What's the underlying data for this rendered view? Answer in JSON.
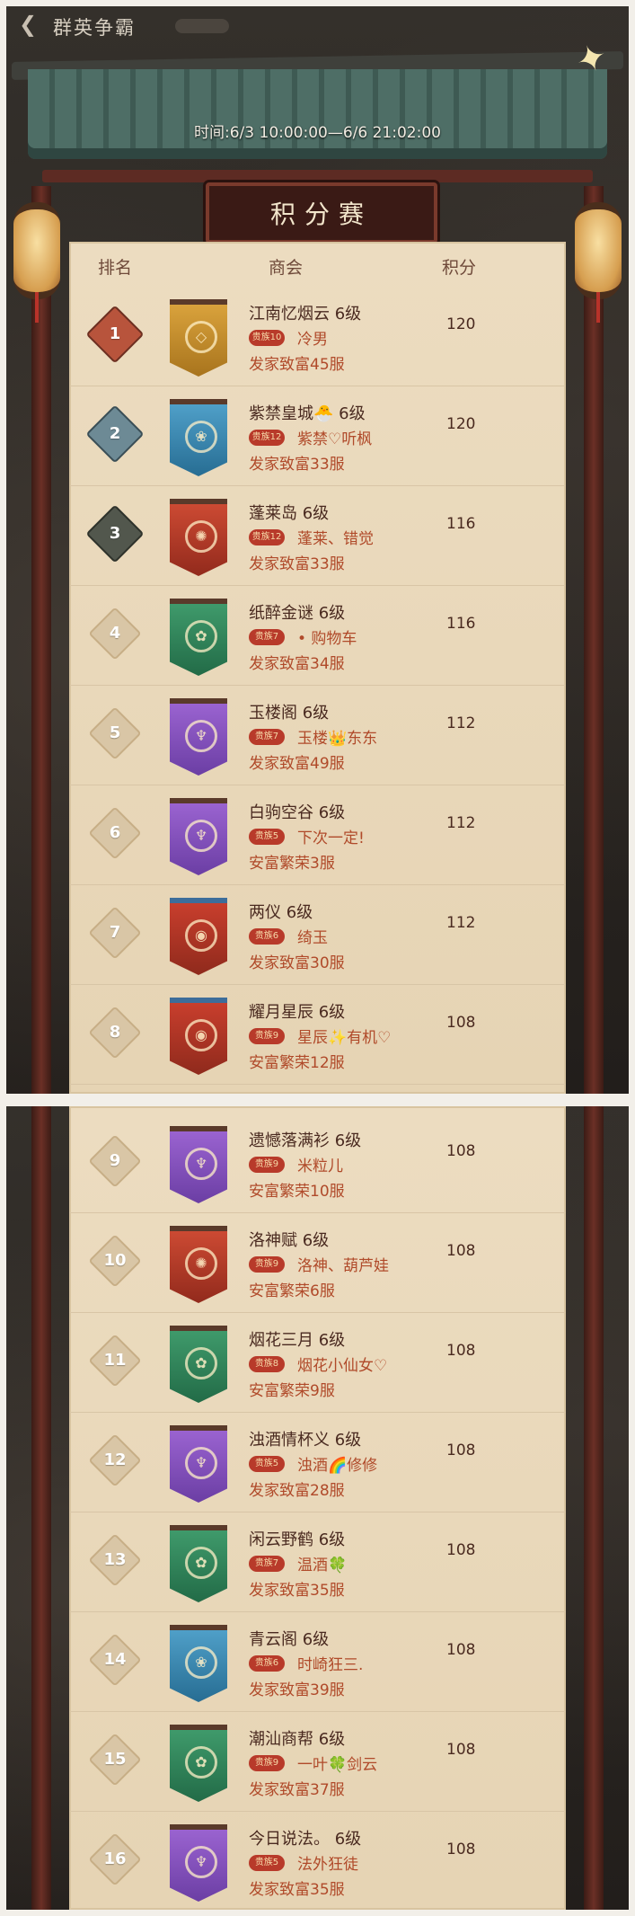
{
  "screen1": {
    "topbar": {
      "back_icon": "back-arrow-icon",
      "title": "群英争霸"
    },
    "time_range": "时间:6/3 10:00:00—6/6 21:02:00",
    "signboard": "积分赛",
    "columns": {
      "rank": "排名",
      "guild": "商会",
      "score": "积分"
    },
    "rows": [
      {
        "rank": "1",
        "badge": "gold",
        "banner": "gold",
        "emblem": "◇",
        "guild": "江南忆烟云 6级",
        "vip": "贵族10",
        "leader": "冷男",
        "server": "发家致富45服",
        "score": "120"
      },
      {
        "rank": "2",
        "badge": "silver",
        "banner": "blue",
        "emblem": "❀",
        "guild": "紫禁皇城🐣 6级",
        "vip": "贵族12",
        "leader": "紫禁♡听枫",
        "server": "发家致富33服",
        "score": "120"
      },
      {
        "rank": "3",
        "badge": "bronze",
        "banner": "red",
        "emblem": "✺",
        "guild": "蓬莱岛 6级",
        "vip": "贵族12",
        "leader": "蓬莱、错觉",
        "server": "发家致富33服",
        "score": "116"
      },
      {
        "rank": "4",
        "badge": "",
        "banner": "green",
        "emblem": "✿",
        "guild": "纸醉金谜 6级",
        "vip": "贵族7",
        "leader": "• 购物车",
        "server": "发家致富34服",
        "score": "116"
      },
      {
        "rank": "5",
        "badge": "",
        "banner": "purple",
        "emblem": "♆",
        "guild": "玉楼阁 6级",
        "vip": "贵族7",
        "leader": "玉楼👑东东",
        "server": "发家致富49服",
        "score": "112"
      },
      {
        "rank": "6",
        "badge": "",
        "banner": "purple",
        "emblem": "♆",
        "guild": "白驹空谷 6级",
        "vip": "贵族5",
        "leader": "下次一定!",
        "server": "安富繁荣3服",
        "score": "112"
      },
      {
        "rank": "7",
        "badge": "",
        "banner": "redcircle",
        "emblem": "◉",
        "guild": "两仪 6级",
        "vip": "贵族6",
        "leader": "绮玉",
        "server": "发家致富30服",
        "score": "112"
      },
      {
        "rank": "8",
        "badge": "",
        "banner": "redcircle",
        "emblem": "◉",
        "guild": "耀月星辰 6级",
        "vip": "贵族9",
        "leader": "星辰✨有机♡",
        "server": "安富繁荣12服",
        "score": "108"
      }
    ]
  },
  "screen2": {
    "rows": [
      {
        "rank": "9",
        "banner": "purple",
        "emblem": "♆",
        "guild": "遗憾落满衫 6级",
        "vip": "贵族9",
        "leader": "米粒儿",
        "server": "安富繁荣10服",
        "score": "108"
      },
      {
        "rank": "10",
        "banner": "red",
        "emblem": "✺",
        "guild": "洛神赋 6级",
        "vip": "贵族9",
        "leader": "洛神、葫芦娃",
        "server": "安富繁荣6服",
        "score": "108"
      },
      {
        "rank": "11",
        "banner": "green",
        "emblem": "✿",
        "guild": "烟花三月 6级",
        "vip": "贵族8",
        "leader": "烟花小仙女♡",
        "server": "安富繁荣9服",
        "score": "108"
      },
      {
        "rank": "12",
        "banner": "purple",
        "emblem": "♆",
        "guild": "浊酒情杯义 6级",
        "vip": "贵族5",
        "leader": "浊酒🌈修修",
        "server": "发家致富28服",
        "score": "108"
      },
      {
        "rank": "13",
        "banner": "green",
        "emblem": "✿",
        "guild": "闲云野鹤 6级",
        "vip": "贵族7",
        "leader": "温酒🍀",
        "server": "发家致富35服",
        "score": "108"
      },
      {
        "rank": "14",
        "banner": "blue",
        "emblem": "❀",
        "guild": "青云阁 6级",
        "vip": "贵族6",
        "leader": "时崎狂三.",
        "server": "发家致富39服",
        "score": "108"
      },
      {
        "rank": "15",
        "banner": "green",
        "emblem": "✿",
        "guild": "潮汕商帮 6级",
        "vip": "贵族9",
        "leader": "一叶🍀剑云",
        "server": "发家致富37服",
        "score": "108"
      },
      {
        "rank": "16",
        "banner": "purple",
        "emblem": "♆",
        "guild": "今日说法。 6级",
        "vip": "贵族5",
        "leader": "法外狂徒",
        "server": "发家致富35服",
        "score": "108"
      }
    ]
  }
}
